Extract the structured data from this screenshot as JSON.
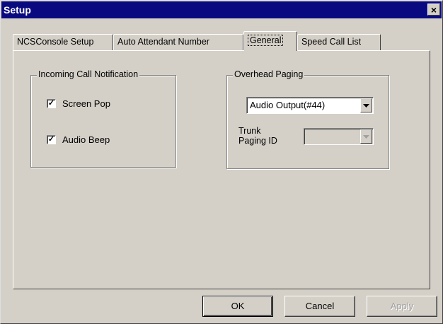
{
  "window": {
    "title": "Setup",
    "close_glyph": "×"
  },
  "tabs": [
    {
      "label": "NCSConsole Setup"
    },
    {
      "label": "Auto Attendant Number"
    },
    {
      "label": "General"
    },
    {
      "label": "Speed Call List"
    }
  ],
  "active_tab": "General",
  "incoming_group": {
    "legend": "Incoming Call Notification",
    "screen_pop": {
      "label": "Screen Pop",
      "checked": true
    },
    "audio_beep": {
      "label": "Audio Beep",
      "checked": true
    }
  },
  "overhead_group": {
    "legend": "Overhead Paging",
    "audio_output": {
      "value": "Audio Output(#44)"
    },
    "trunk_paging_label_line1": "Trunk",
    "trunk_paging_label_line2": "Paging ID",
    "trunk_paging": {
      "value": "",
      "disabled": true
    }
  },
  "buttons": {
    "ok": "OK",
    "cancel": "Cancel",
    "apply": "Apply"
  },
  "check_glyph": "✓"
}
